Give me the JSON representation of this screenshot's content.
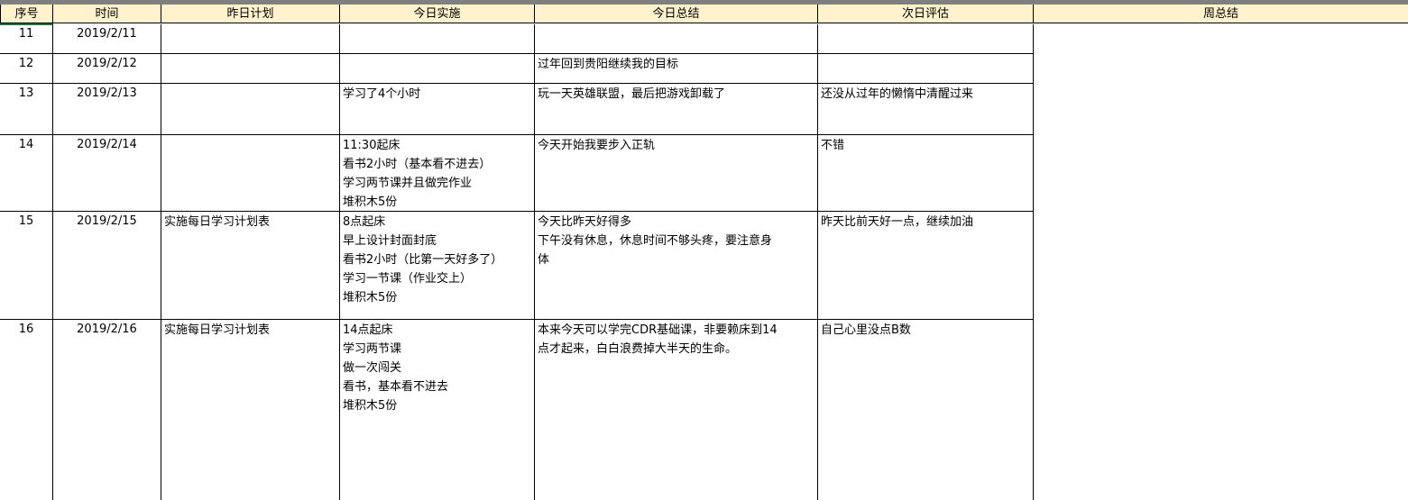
{
  "table": {
    "headers": [
      "序号",
      "时间",
      "昨日计划",
      "今日实施",
      "今日总结",
      "次日评估",
      "周总结"
    ],
    "rows": [
      {
        "no": "11",
        "date": "2019/2/11",
        "plan": "",
        "impl": "",
        "summary": "",
        "eval": ""
      },
      {
        "no": "12",
        "date": "2019/2/12",
        "plan": "",
        "impl": "",
        "summary": "过年回到贵阳继续我的目标",
        "eval": ""
      },
      {
        "no": "13",
        "date": "2019/2/13",
        "plan": "",
        "impl": "学习了4个小时",
        "summary": "玩一天英雄联盟，最后把游戏卸载了",
        "eval": "还没从过年的懒惰中清醒过来"
      },
      {
        "no": "14",
        "date": "2019/2/14",
        "plan": "",
        "impl": "11:30起床\n看书2小时（基本看不进去）\n学习两节课并且做完作业\n堆积木5份",
        "summary": "今天开始我要步入正轨",
        "eval": "不错"
      },
      {
        "no": "15",
        "date": "2019/2/15",
        "plan": "实施每日学习计划表",
        "impl": "8点起床\n早上设计封面封底\n看书2小时（比第一天好多了）\n学习一节课（作业交上）\n堆积木5份",
        "summary": "今天比昨天好得多\n下午没有休息，休息时间不够头疼，要注意身\n体",
        "eval": "昨天比前天好一点，继续加油"
      },
      {
        "no": "16",
        "date": "2019/2/16",
        "plan": "实施每日学习计划表",
        "impl": "14点起床\n学习两节课\n做一次闯关\n看书，基本看不进去\n堆积木5份",
        "summary": "本来今天可以学完CDR基础课，非要赖床到14\n点才起来，白白浪费掉大半天的生命。",
        "eval": "自己心里没点B数"
      }
    ]
  }
}
